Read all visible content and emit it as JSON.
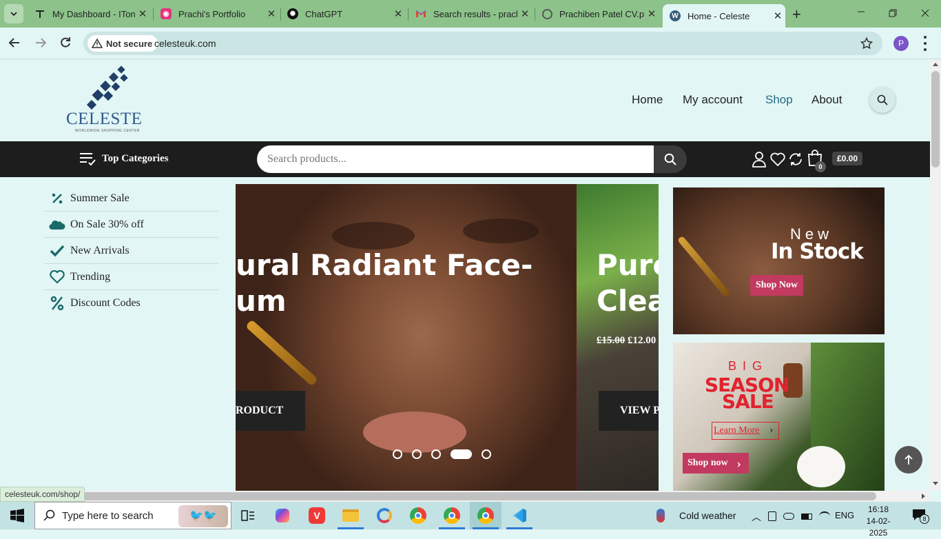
{
  "browser": {
    "tabs": [
      {
        "label": "My Dashboard - ITon",
        "icon": "itonics-icon"
      },
      {
        "label": "Prachi's Portfolio",
        "icon": "portfolio-icon"
      },
      {
        "label": "ChatGPT",
        "icon": "chatgpt-icon"
      },
      {
        "label": "Search results - prach",
        "icon": "gmail-icon"
      },
      {
        "label": "Prachiben Patel CV.p",
        "icon": "globe-icon"
      },
      {
        "label": "Home - Celeste",
        "icon": "wordpress-icon",
        "active": true
      }
    ],
    "security_label": "Not secure",
    "url": "celesteuk.com",
    "profile_initial": "P",
    "status_url": "celesteuk.com/shop/"
  },
  "site": {
    "logo_text": "CELESTE",
    "logo_tagline": "WORLDWIDE SHOPPING CENTER",
    "nav": [
      {
        "label": "Home"
      },
      {
        "label": "My account"
      },
      {
        "label": "Shop",
        "active": true
      },
      {
        "label": "About"
      }
    ],
    "top_categories_label": "Top Categories",
    "search_placeholder": "Search products...",
    "cart_count": "0",
    "cart_total": "£0.00",
    "sidebar": [
      {
        "label": "Summer Sale",
        "icon": "percent-slash-icon"
      },
      {
        "label": "On Sale 30% off",
        "icon": "salesforce-cloud-icon"
      },
      {
        "label": "New Arrivals",
        "icon": "check-icon"
      },
      {
        "label": "Trending",
        "icon": "heart-icon"
      },
      {
        "label": "Discount Codes",
        "icon": "percent-icon"
      }
    ],
    "hero": {
      "slide1_title_line1": "ural Radiant Face-",
      "slide1_title_line2": "um",
      "slide1_button": "RODUCT",
      "slide2_title_line1": "Pure",
      "slide2_title_line2": "Clea",
      "slide2_old_price": "£15.00",
      "slide2_new_price": "£12.00",
      "slide2_button": "VIEW P",
      "dots": 5,
      "active_dot": 4
    },
    "promo1": {
      "line1": "New",
      "line2": "In Stock",
      "button": "Shop Now"
    },
    "promo2": {
      "line1": "BIG",
      "line2": "SEASON",
      "line3": "SALE",
      "link": "Learn More",
      "button": "Shop now"
    }
  },
  "taskbar": {
    "search_placeholder": "Type here to search",
    "weather": "Cold weather",
    "language": "ENG",
    "time": "16:18",
    "date": "14-02-2025",
    "notification_count": "8"
  }
}
